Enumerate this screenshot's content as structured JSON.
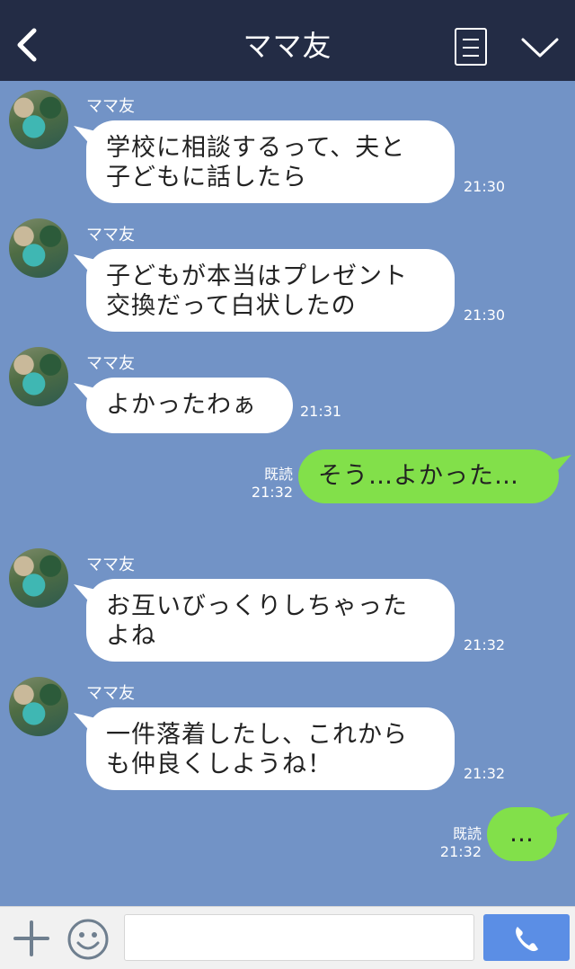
{
  "header": {
    "title": "ママ友",
    "back_icon": "back-chevron-icon",
    "menu_icon": "menu-list-icon",
    "collapse_icon": "chevron-down-icon"
  },
  "messages": [
    {
      "side": "left",
      "sender": "ママ友",
      "lines": [
        "学校に相談するって、夫と",
        "子どもに話したら"
      ],
      "time": "21:30"
    },
    {
      "side": "left",
      "sender": "ママ友",
      "lines": [
        "子どもが本当はプレゼント",
        "交換だって白状したの"
      ],
      "time": "21:30"
    },
    {
      "side": "left",
      "sender": "ママ友",
      "lines": [
        "よかったわぁ"
      ],
      "time": "21:31"
    },
    {
      "side": "right",
      "read": "既読",
      "lines": [
        "そう…よかった…"
      ],
      "time": "21:32"
    },
    {
      "side": "left",
      "sender": "ママ友",
      "lines": [
        "お互いびっくりしちゃった",
        "よね"
      ],
      "time": "21:32"
    },
    {
      "side": "left",
      "sender": "ママ友",
      "lines": [
        "一件落着したし、これから",
        "も仲良くしようね！"
      ],
      "time": "21:32"
    },
    {
      "side": "right",
      "read": "既読",
      "lines": [
        "…"
      ],
      "time": "21:32"
    }
  ],
  "footer": {
    "plus_icon": "plus-icon",
    "emoji_icon": "smiley-icon",
    "input_value": "",
    "call_icon": "phone-icon"
  },
  "colors": {
    "header_bg": "#232c45",
    "chat_bg": "#7293c6",
    "bubble_in": "#ffffff",
    "bubble_out": "#82e04a",
    "call_button": "#5b8ee5"
  }
}
